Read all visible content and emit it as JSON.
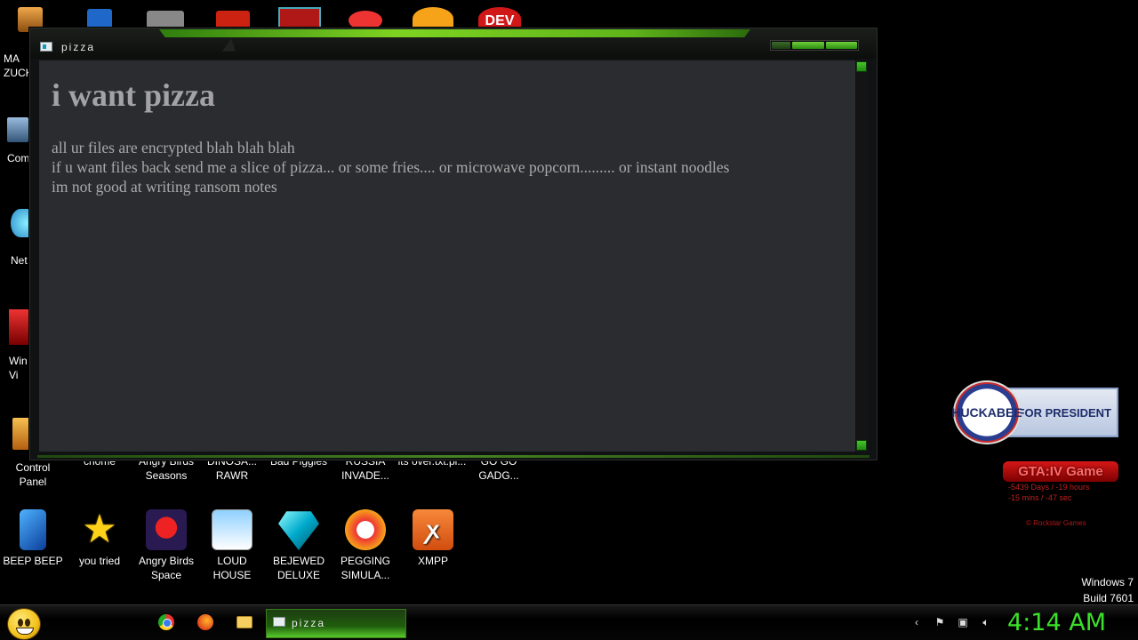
{
  "window": {
    "title": "pizza",
    "heading": "i want pizza",
    "lines": [
      "all ur files are encrypted blah blah blah",
      "if u want files back send me a slice of pizza... or some fries.... or microwave popcorn......... or instant noodles",
      "im not good at writing ransom notes"
    ]
  },
  "desktop_left_labels": {
    "mark": "MA ZUCK",
    "computer": "Com",
    "network": "Net",
    "win_vi": "Win Vi",
    "control_panel": "Control Panel"
  },
  "desktop_row1": [
    "chome",
    "Angry Birds Seasons",
    "DINOSA... RAWR",
    "Bad Piggies",
    "RUSSIA INVADE...",
    "its over.txt.pi...",
    "GO GO GADG..."
  ],
  "desktop_row2": [
    "BEEP BEEP",
    "you tried",
    "Angry Birds Space",
    "LOUD HOUSE",
    "BEJEWED DELUXE",
    "PEGGING SIMULA...",
    "XMPP"
  ],
  "desktop_top_partial": {
    "dev_label": "DEV"
  },
  "widgets": {
    "huckabee_name": "HUCKABEE",
    "huckabee_slogan": "FOR PRESIDENT",
    "gta_title": "GTA:IV Game",
    "gta_line1": "-5439 Days / -19 hours",
    "gta_line2": "-15 mins / -47 sec",
    "gta_copy": "© Rockstar Games"
  },
  "os": {
    "version": "Windows 7",
    "build": "Build 7601"
  },
  "taskbar": {
    "task_label": "pizza",
    "clock": "4:14 AM"
  }
}
